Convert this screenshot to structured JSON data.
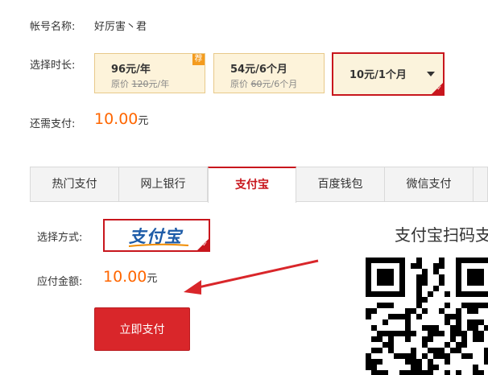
{
  "account": {
    "label": "帐号名称:",
    "value": "好厉害丶君"
  },
  "duration": {
    "label": "选择时长:",
    "plans": [
      {
        "price": "96元/年",
        "orig_prefix": "原价",
        "orig_value": "120",
        "orig_suffix": "元/年",
        "badge": "荐"
      },
      {
        "price": "54元/6个月",
        "orig_prefix": "原价",
        "orig_value": "60",
        "orig_suffix": "元/6个月"
      },
      {
        "price": "10元/1个月"
      }
    ]
  },
  "due": {
    "label": "还需支付:",
    "amount": "10.00",
    "unit": "元"
  },
  "tabs": [
    "热门支付",
    "网上银行",
    "支付宝",
    "百度钱包",
    "微信支付"
  ],
  "method": {
    "label": "选择方式:",
    "logo_text": "支付宝"
  },
  "payable": {
    "label": "应付金额:",
    "amount": "10.00",
    "unit": "元"
  },
  "pay_button": "立即支付",
  "qr": {
    "title": "支付宝扫码支"
  },
  "colors": {
    "accent": "#c8161d",
    "amount": "#ff6600",
    "alipay_blue": "#1e5ca8"
  }
}
